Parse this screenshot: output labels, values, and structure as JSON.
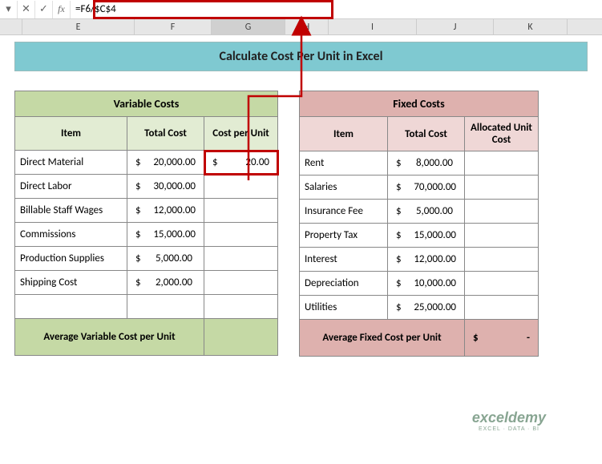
{
  "formula_bar": {
    "fx_label": "fx",
    "formula": "=F6/$C$4"
  },
  "columns": {
    "E": "E",
    "F": "F",
    "G": "G",
    "H": "H",
    "I": "I",
    "J": "J",
    "K": "K"
  },
  "title": "Calculate Cost Per Unit in Excel",
  "variable": {
    "title": "Variable Costs",
    "h_item": "Item",
    "h_total": "Total Cost",
    "h_cpu": "Cost per Unit",
    "rows": [
      {
        "item": "Direct Material",
        "total_s": "$",
        "total_v": "20,000.00",
        "cpu_s": "$",
        "cpu_v": "20.00"
      },
      {
        "item": "Direct Labor",
        "total_s": "$",
        "total_v": "30,000.00",
        "cpu_s": "",
        "cpu_v": ""
      },
      {
        "item": "Billable Staff Wages",
        "total_s": "$",
        "total_v": "12,000.00",
        "cpu_s": "",
        "cpu_v": ""
      },
      {
        "item": "Commissions",
        "total_s": "$",
        "total_v": "15,000.00",
        "cpu_s": "",
        "cpu_v": ""
      },
      {
        "item": "Production Supplies",
        "total_s": "$",
        "total_v": "5,000.00",
        "cpu_s": "",
        "cpu_v": ""
      },
      {
        "item": "Shipping Cost",
        "total_s": "$",
        "total_v": "2,000.00",
        "cpu_s": "",
        "cpu_v": ""
      }
    ],
    "avg_label": "Average Variable Cost per Unit",
    "avg_value": ""
  },
  "fixed": {
    "title": "Fixed Costs",
    "h_item": "Item",
    "h_total": "Total Cost",
    "h_auc": "Allocated Unit Cost",
    "rows": [
      {
        "item": "Rent",
        "total_s": "$",
        "total_v": "8,000.00"
      },
      {
        "item": "Salaries",
        "total_s": "$",
        "total_v": "70,000.00"
      },
      {
        "item": "Insurance Fee",
        "total_s": "$",
        "total_v": "5,000.00"
      },
      {
        "item": "Property Tax",
        "total_s": "$",
        "total_v": "15,000.00"
      },
      {
        "item": "Interest",
        "total_s": "$",
        "total_v": "12,000.00"
      },
      {
        "item": "Depreciation",
        "total_s": "$",
        "total_v": "10,000.00"
      },
      {
        "item": "Utilities",
        "total_s": "$",
        "total_v": "25,000.00"
      }
    ],
    "avg_label": "Average Fixed Cost per Unit",
    "avg_s": "$",
    "avg_v": "-"
  },
  "watermark": {
    "line1": "exceldemy",
    "line2": "EXCEL · DATA · BI"
  },
  "chart_data": {
    "type": "table",
    "tables": [
      {
        "name": "Variable Costs",
        "columns": [
          "Item",
          "Total Cost",
          "Cost per Unit"
        ],
        "rows": [
          [
            "Direct Material",
            20000.0,
            20.0
          ],
          [
            "Direct Labor",
            30000.0,
            null
          ],
          [
            "Billable Staff Wages",
            12000.0,
            null
          ],
          [
            "Commissions",
            15000.0,
            null
          ],
          [
            "Production Supplies",
            5000.0,
            null
          ],
          [
            "Shipping Cost",
            2000.0,
            null
          ]
        ],
        "footer": [
          "Average Variable Cost per Unit",
          null
        ]
      },
      {
        "name": "Fixed Costs",
        "columns": [
          "Item",
          "Total Cost",
          "Allocated Unit Cost"
        ],
        "rows": [
          [
            "Rent",
            8000.0,
            null
          ],
          [
            "Salaries",
            70000.0,
            null
          ],
          [
            "Insurance Fee",
            5000.0,
            null
          ],
          [
            "Property Tax",
            15000.0,
            null
          ],
          [
            "Interest",
            12000.0,
            null
          ],
          [
            "Depreciation",
            10000.0,
            null
          ],
          [
            "Utilities",
            25000.0,
            null
          ]
        ],
        "footer": [
          "Average Fixed Cost per Unit",
          0
        ]
      }
    ],
    "formula": "=F6/$C$4"
  }
}
